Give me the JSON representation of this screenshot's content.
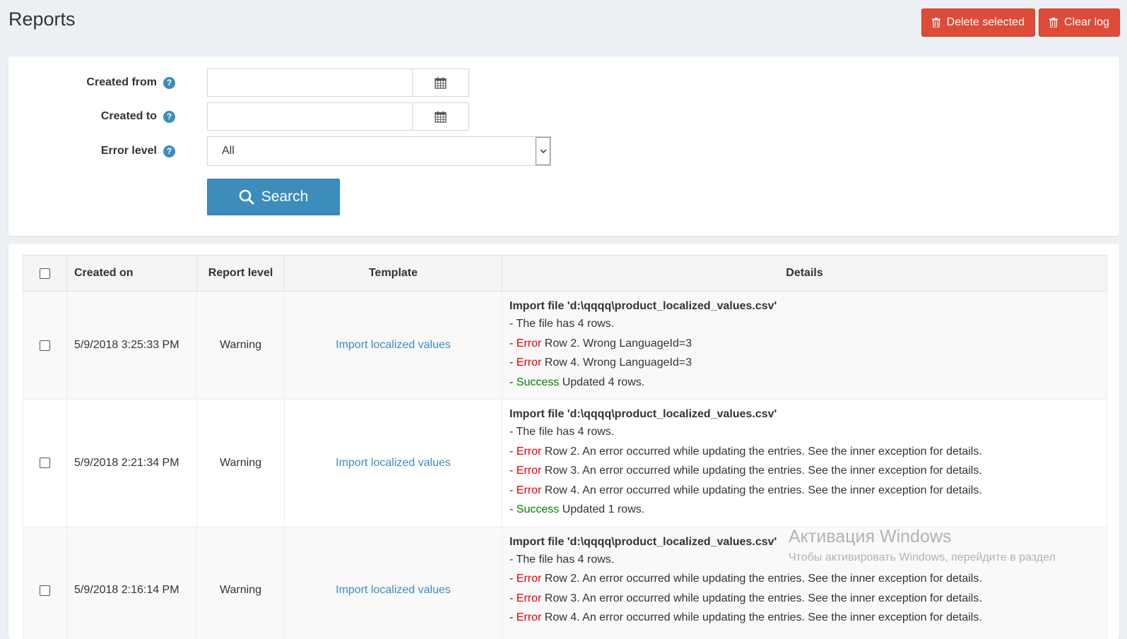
{
  "page": {
    "title": "Reports"
  },
  "toolbar": {
    "delete_selected": "Delete selected",
    "clear_log": "Clear log"
  },
  "filters": {
    "created_from": {
      "label": "Created from",
      "value": ""
    },
    "created_to": {
      "label": "Created to",
      "value": ""
    },
    "error_level": {
      "label": "Error level",
      "selected": "All"
    },
    "help_glyph": "?",
    "search_label": "Search"
  },
  "table": {
    "headers": {
      "created_on": "Created on",
      "report_level": "Report level",
      "template": "Template",
      "details": "Details"
    },
    "rows": [
      {
        "created_on": "5/9/2018 3:25:33 PM",
        "level": "Warning",
        "template": "Import localized values",
        "details_title": "Import file 'd:\\qqqq\\product_localized_values.csv'",
        "lines": [
          {
            "prefix": "- ",
            "level": "",
            "text": "The file has 4 rows."
          },
          {
            "prefix": "- ",
            "level": "Error",
            "text": " Row 2. Wrong LanguageId=3"
          },
          {
            "prefix": "- ",
            "level": "Error",
            "text": " Row 4. Wrong LanguageId=3"
          },
          {
            "prefix": "- ",
            "level": "Success",
            "text": " Updated 4 rows."
          }
        ]
      },
      {
        "created_on": "5/9/2018 2:21:34 PM",
        "level": "Warning",
        "template": "Import localized values",
        "details_title": "Import file 'd:\\qqqq\\product_localized_values.csv'",
        "lines": [
          {
            "prefix": "- ",
            "level": "",
            "text": "The file has 4 rows."
          },
          {
            "prefix": "- ",
            "level": "Error",
            "text": " Row 2. An error occurred while updating the entries. See the inner exception for details."
          },
          {
            "prefix": "- ",
            "level": "Error",
            "text": " Row 3. An error occurred while updating the entries. See the inner exception for details."
          },
          {
            "prefix": "- ",
            "level": "Error",
            "text": " Row 4. An error occurred while updating the entries. See the inner exception for details."
          },
          {
            "prefix": "- ",
            "level": "Success",
            "text": " Updated 1 rows."
          }
        ]
      },
      {
        "created_on": "5/9/2018 2:16:14 PM",
        "level": "Warning",
        "template": "Import localized values",
        "details_title": "Import file 'd:\\qqqq\\product_localized_values.csv'",
        "lines": [
          {
            "prefix": "- ",
            "level": "",
            "text": "The file has 4 rows."
          },
          {
            "prefix": "- ",
            "level": "Error",
            "text": " Row 2. An error occurred while updating the entries. See the inner exception for details."
          },
          {
            "prefix": "- ",
            "level": "Error",
            "text": " Row 3. An error occurred while updating the entries. See the inner exception for details."
          },
          {
            "prefix": "- ",
            "level": "Error",
            "text": " Row 4. An error occurred while updating the entries. See the inner exception for details."
          }
        ]
      }
    ]
  },
  "watermark": {
    "title": "Активация Windows",
    "subtitle": "Чтобы активировать Windows, перейдите в раздел"
  },
  "colors": {
    "accent": "#3c8dbc",
    "danger": "#dd4b39",
    "error_text": "#e30000",
    "success_text": "#008000"
  }
}
